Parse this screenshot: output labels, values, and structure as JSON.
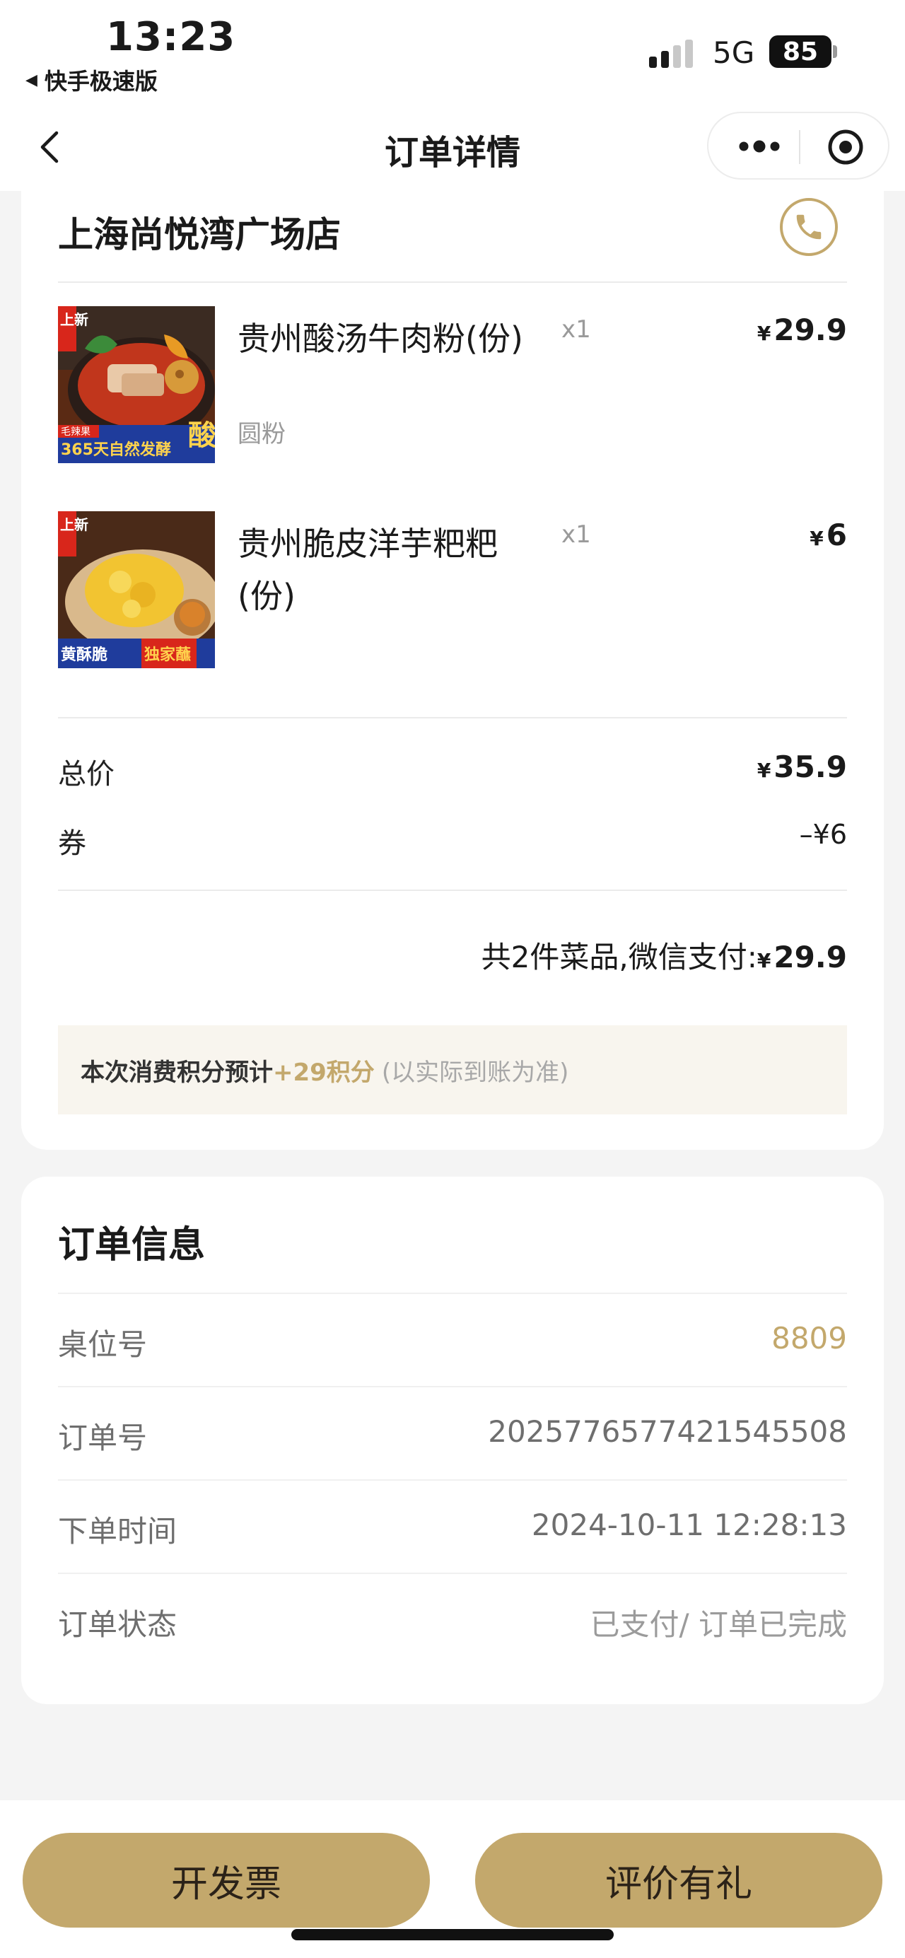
{
  "status_bar": {
    "time": "13:23",
    "back_app": "快手极速版",
    "network": "5G",
    "battery": "85"
  },
  "nav": {
    "title": "订单详情",
    "icons": [
      "back-chevron-icon",
      "more-dots-icon",
      "target-circle-icon"
    ]
  },
  "order": {
    "store_name": "上海尚悦湾广场店",
    "items": [
      {
        "name": "贵州酸汤牛肉粉(份)",
        "spec": "圆粉",
        "qty": "x1",
        "currency": "¥",
        "price": "29.9",
        "image_text": [
          "上新",
          "毛辣果",
          "365天自然发酵",
          "酸"
        ]
      },
      {
        "name": "贵州脆皮洋芋粑粑(份)",
        "spec": "",
        "qty": "x1",
        "currency": "¥",
        "price": "6",
        "image_text": [
          "上新",
          "黄酥脆",
          "独家蘸"
        ]
      }
    ],
    "total_label": "总价",
    "total_currency": "¥",
    "total_value": "35.9",
    "coupon_label": "券",
    "coupon_value": "–¥6",
    "summary_text": "共2件菜品,微信支付:",
    "summary_currency": "¥",
    "summary_amount": "29.9",
    "points_prefix": "本次消费积分预计",
    "points_value": "+29积分",
    "points_note": "(以实际到账为准)"
  },
  "order_info": {
    "title": "订单信息",
    "rows": [
      {
        "label": "桌位号",
        "value": "8809"
      },
      {
        "label": "订单号",
        "value": "2025776577421545508"
      },
      {
        "label": "下单时间",
        "value": "2024-10-11 12:28:13"
      },
      {
        "label": "订单状态",
        "value": "已支付/ 订单已完成"
      }
    ]
  },
  "actions": {
    "invoice_label": "开发票",
    "review_label": "评价有礼"
  },
  "colors": {
    "accent_gold": "#c3a86c",
    "points_bg": "#f8f5ee",
    "page_bg": "#f4f4f4"
  }
}
